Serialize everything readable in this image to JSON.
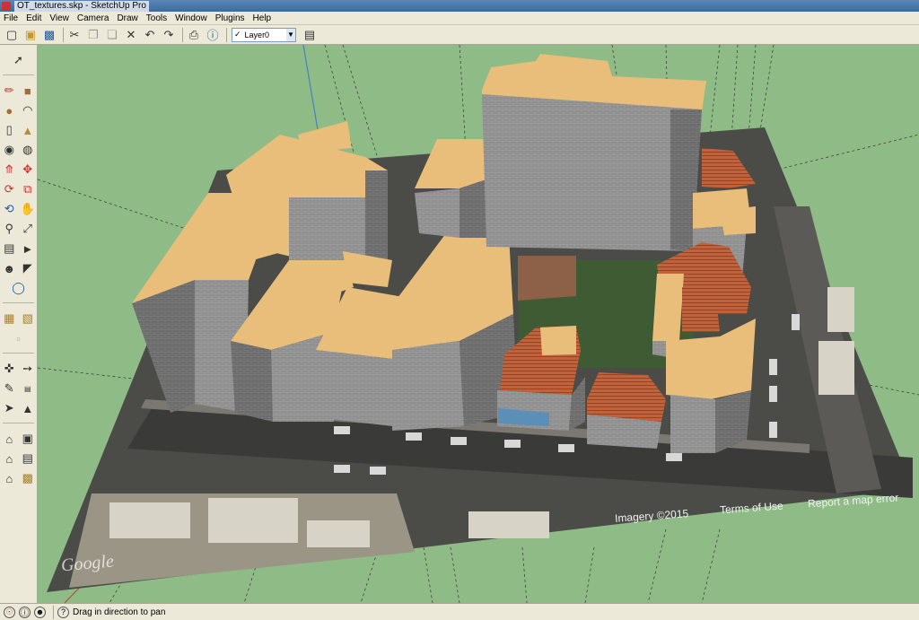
{
  "window": {
    "title": "OT_textures.skp - SketchUp Pro"
  },
  "menu": [
    "File",
    "Edit",
    "View",
    "Camera",
    "Draw",
    "Tools",
    "Window",
    "Plugins",
    "Help"
  ],
  "toolbar": {
    "buttons": [
      "new-icon",
      "open-icon",
      "save-icon",
      "cut-icon",
      "copy-icon",
      "paste-icon",
      "erase-icon",
      "undo-icon",
      "redo-icon",
      "print-icon",
      "model-info-icon"
    ],
    "layer_value": "Layer0",
    "layer_check": "✓"
  },
  "left_tools": [
    [
      "select-icon"
    ],
    [
      "pencil-icon",
      "rectangle-icon"
    ],
    [
      "circle-icon",
      "arc-icon"
    ],
    [
      "eraser-icon",
      "paint-bucket-icon"
    ],
    [
      "tape-measure-icon",
      "protractor-icon"
    ],
    [
      "push-pull-icon",
      "move-icon"
    ],
    [
      "rotate-icon",
      "offset-icon"
    ],
    [
      "orbit-icon",
      "pan-icon"
    ],
    [
      "zoom-icon",
      "zoom-extents-icon"
    ],
    [
      "position-camera-icon",
      "walk-icon"
    ],
    [
      "look-around-icon",
      "section-plane-icon"
    ],
    [
      "get-models-icon"
    ],
    [
      "add-location-icon",
      "toggle-terrain-icon"
    ],
    [
      "photo-textures-icon"
    ],
    [
      "dimension-icon",
      "axes-icon"
    ],
    [
      "text-icon",
      "3d-text-icon"
    ],
    [
      "follow-me-icon",
      "scale-icon"
    ],
    [
      "iso-view-icon",
      "top-view-icon"
    ],
    [
      "front-view-icon",
      "right-view-icon"
    ],
    [
      "back-view-icon",
      "left-view-icon"
    ]
  ],
  "map_credits": {
    "imagery": "Imagery ©2015",
    "terms": "Terms of Use",
    "report": "Report a map error",
    "logo": "Google"
  },
  "status": {
    "text": "Drag in direction to pan"
  },
  "colors": {
    "ground": "#8fbb87",
    "roof": "#e8be7a",
    "wall": "#8c8c8c",
    "tile_roof": "#c0623a"
  }
}
